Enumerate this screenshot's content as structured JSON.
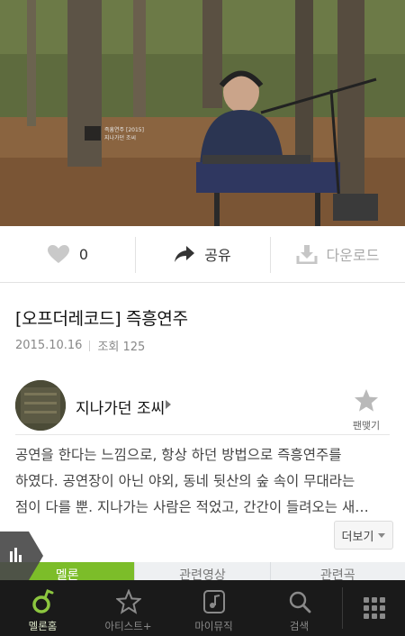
{
  "video": {
    "caption_line1": "즉흥연주 [2015]",
    "caption_line2": "지나가던 조씨"
  },
  "actions": {
    "like_count": "0",
    "share_label": "공유",
    "download_label": "다운로드"
  },
  "content": {
    "title": "[오프더레코드] 즉흥연주",
    "date": "2015.10.16",
    "views": "조회 125"
  },
  "artist": {
    "name": "지나가던 조씨",
    "fan_label": "팬맺기"
  },
  "description": {
    "lines": [
      "공연을 한다는 느낌으로, 항상 하던 방법으로 즉흥연주를",
      "하였다. 공연장이 아닌 야외, 동네 뒷산의 숲 속이 무대라는",
      "점이 다를 뿐. 지나가는 사람은 적었고, 간간이 들려오는 새…"
    ],
    "more_label": "더보기"
  },
  "tabs": [
    "멜론",
    "관련영상",
    "관련곡"
  ],
  "colors": {
    "accent": "#7cbd29",
    "nav_bg": "#1a1a1a"
  },
  "bottom_nav": {
    "items": [
      {
        "label": "멜론홈",
        "icon": "melon-note-icon"
      },
      {
        "label": "아티스트+",
        "icon": "star-outline-icon"
      },
      {
        "label": "마이뮤직",
        "icon": "music-note-box-icon"
      },
      {
        "label": "검색",
        "icon": "search-icon"
      }
    ],
    "menu_icon": "grid-menu-icon"
  }
}
